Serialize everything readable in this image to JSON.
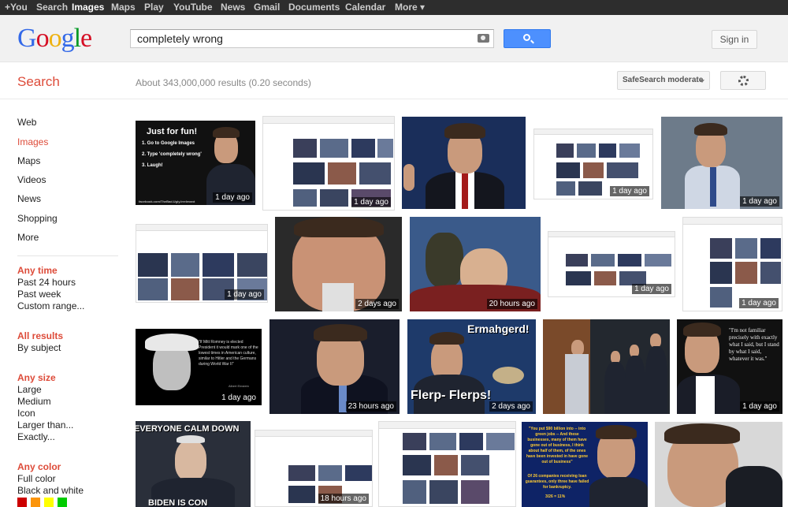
{
  "topbar": {
    "items": [
      "+You",
      "Search",
      "Images",
      "Maps",
      "Play",
      "YouTube",
      "News",
      "Gmail",
      "Documents",
      "Calendar",
      "More ▾"
    ],
    "active": "Images"
  },
  "header": {
    "logo": "Google",
    "search_value": "completely wrong",
    "sign_in": "Sign in"
  },
  "subheader": {
    "title": "Search",
    "stats": "About 343,000,000 results (0.20 seconds)",
    "safesearch": "SafeSearch moderate"
  },
  "leftnav": {
    "types": [
      "Web",
      "Images",
      "Maps",
      "Videos",
      "News",
      "Shopping",
      "More"
    ],
    "active_type": "Images",
    "time": {
      "header": "Any time",
      "options": [
        "Past 24 hours",
        "Past week",
        "Custom range..."
      ]
    },
    "results": {
      "header": "All results",
      "options": [
        "By subject"
      ]
    },
    "size": {
      "header": "Any size",
      "options": [
        "Large",
        "Medium",
        "Icon",
        "Larger than...",
        "Exactly..."
      ]
    },
    "color": {
      "header": "Any color",
      "options": [
        "Full color",
        "Black and white"
      ]
    },
    "swatches": [
      "#cc0000",
      "#fb940b",
      "#ffff00",
      "#00cc00"
    ]
  },
  "images": [
    {
      "age": "1 day ago",
      "caption": "Just for fun!",
      "lines": [
        "1. Go to Google Images",
        "2. Type 'completely wrong'",
        "3. Laugh!"
      ],
      "footer": "facebook.com/TheBad.Ugly.Irrelevant"
    },
    {
      "age": "1 day ago"
    },
    {
      "age": ""
    },
    {
      "age": "1 day ago"
    },
    {
      "age": "1 day ago"
    },
    {
      "age": "1 day ago"
    },
    {
      "age": "2 days ago"
    },
    {
      "age": "20 hours ago"
    },
    {
      "age": "1 day ago"
    },
    {
      "age": "1 day ago"
    },
    {
      "age": "1 day ago",
      "quote": "\"If Mitt Romney is elected President it would mark one of the lowest times in American culture, similar to Hitler and the Germans during World War II\"",
      "author": "Albert Einstein"
    },
    {
      "age": "23 hours ago"
    },
    {
      "age": "2 days ago",
      "top": "Ermahgerd!",
      "bottom": "Flerp- Flerps!"
    },
    {
      "age": ""
    },
    {
      "age": "1 day ago",
      "quote": "\"I'm not familiar precisely with exactly what I said, but I stand by what I said, whatever it was.\""
    },
    {
      "age": "",
      "top": "EVERYONE CALM DOWN",
      "bottom": "BIDEN IS CON"
    },
    {
      "age": "18 hours ago"
    },
    {
      "age": ""
    },
    {
      "age": "",
      "quote": "\"You put $90 billion into -- into green jobs -- And these businesses, many of them have gone out of business, I think about half of them, of the ones have been invested in have gone out of business\"",
      "stat": "Of 26 companies receiving loan guarantees, only three have failed for bankruptcy.",
      "ratio": "3/26 = 11%"
    },
    {
      "age": ""
    }
  ]
}
